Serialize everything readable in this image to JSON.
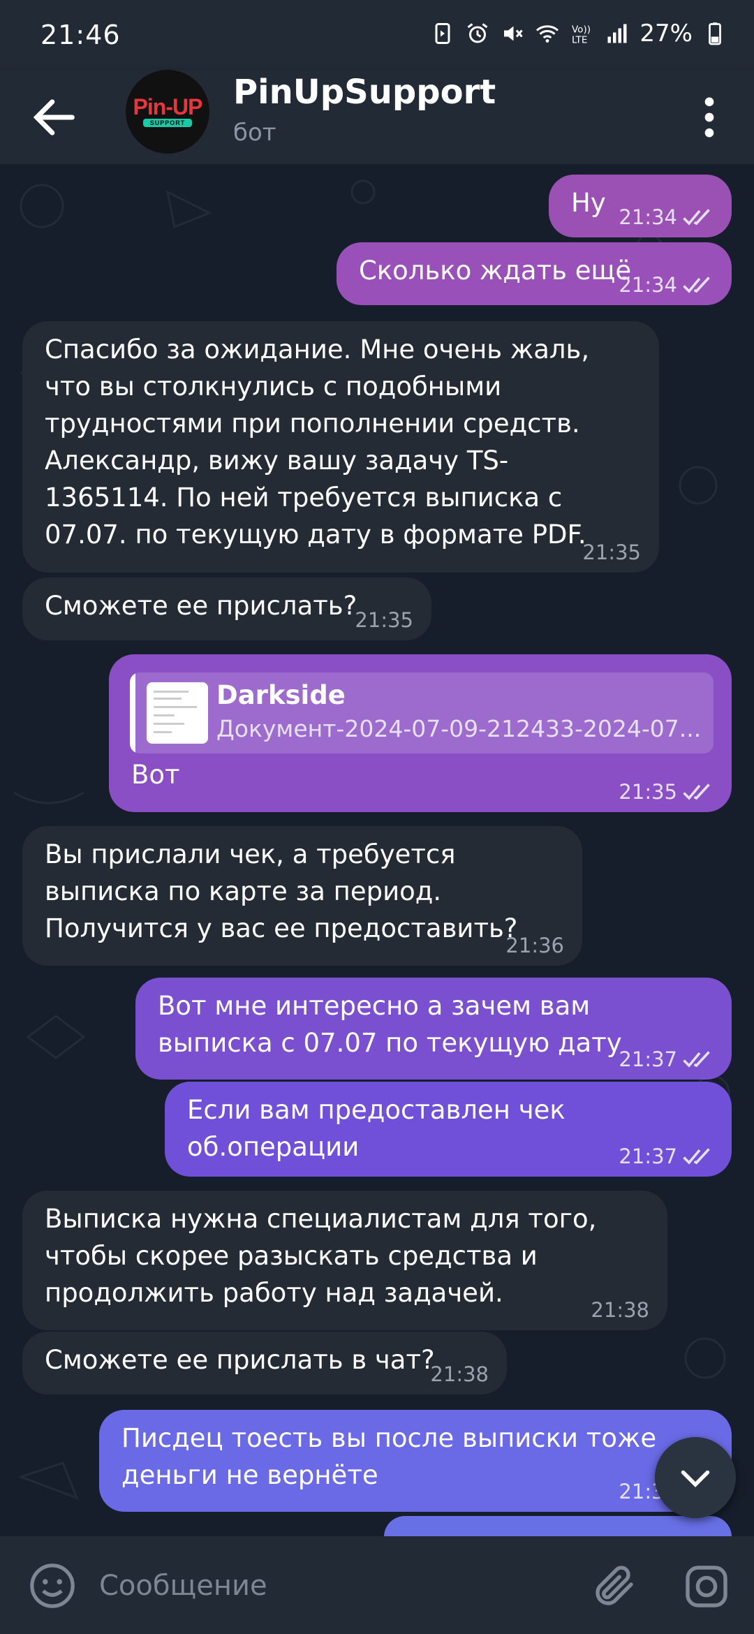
{
  "status_bar": {
    "time": "21:46",
    "battery": "27%",
    "icons": [
      "sim-icon",
      "alarm-icon",
      "mute-icon",
      "wifi-icon",
      "volte-icon",
      "signal-icon",
      "battery-icon"
    ]
  },
  "header": {
    "title": "PinUpSupport",
    "subtitle": "бот",
    "avatar_logo_top": "Pin-UP",
    "avatar_logo_bottom": "SUPPORT"
  },
  "messages": [
    {
      "dir": "out",
      "text": "Ну",
      "time": "21:34",
      "read": true
    },
    {
      "dir": "out",
      "text": "Сколько ждать ещё",
      "time": "21:34",
      "read": true
    },
    {
      "dir": "in",
      "text": "Спасибо за ожидание. Мне очень жаль, что вы столкнулись с подобными трудностями при пополнении средств. Александр, вижу вашу задачу TS-1365114. По ней требуется выписка с 07.07. по текущую дату в формате PDF.",
      "time": "21:35"
    },
    {
      "dir": "in",
      "text": "Сможете ее прислать?",
      "time": "21:35"
    },
    {
      "dir": "out",
      "text": "Вот",
      "time": "21:35",
      "read": true,
      "attachment": {
        "name": "Darkside",
        "file": "Документ-2024-07-09-212433-2024-07..."
      }
    },
    {
      "dir": "in",
      "text": "Вы прислали чек, а требуется выписка по карте за период. Получится у вас ее предоставить?",
      "time": "21:36"
    },
    {
      "dir": "out",
      "text": "Вот мне интересно а зачем вам выписка с 07.07 по текущую дату",
      "time": "21:37",
      "read": true
    },
    {
      "dir": "out",
      "text": "Если вам предоставлен чек об.операции",
      "time": "21:37",
      "read": true
    },
    {
      "dir": "in",
      "text": "Выписка нужна специалистам для того, чтобы скорее разыскать средства и продолжить работу над задачей.",
      "time": "21:38"
    },
    {
      "dir": "in",
      "text": "Сможете ее прислать в чат?",
      "time": "21:38"
    },
    {
      "dir": "out",
      "text": "Писдец тоесть вы после выписки тоже деньги не вернёте",
      "time": "21:38",
      "read": true
    }
  ],
  "input": {
    "placeholder": "Сообщение"
  },
  "colors": {
    "incoming_bubble": "#252b35",
    "outgoing_top": "#9b50b4",
    "outgoing_bottom": "#6a6ae6",
    "background": "#161e2b"
  }
}
